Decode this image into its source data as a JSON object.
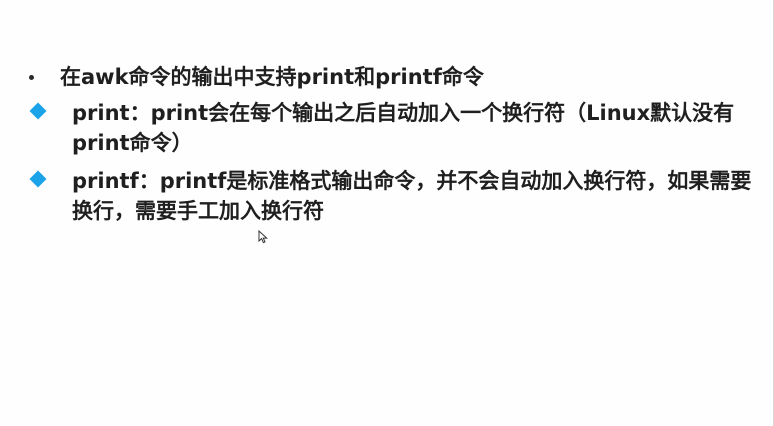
{
  "bullets": [
    {
      "icon": "bullet-dot-icon",
      "text": "在awk命令的输出中支持print和printf命令"
    },
    {
      "icon": "diamond-bullet-icon",
      "text": "print：print会在每个输出之后自动加入一个换行符（Linux默认没有print命令）"
    },
    {
      "icon": "diamond-bullet-icon",
      "text": "printf：printf是标准格式输出命令，并不会自动加入换行符，如果需要换行，需要手工加入换行符"
    }
  ],
  "colors": {
    "text": "#1f1f1f",
    "accent_diamond": "#1aa3e8",
    "background": "#fefefe"
  }
}
